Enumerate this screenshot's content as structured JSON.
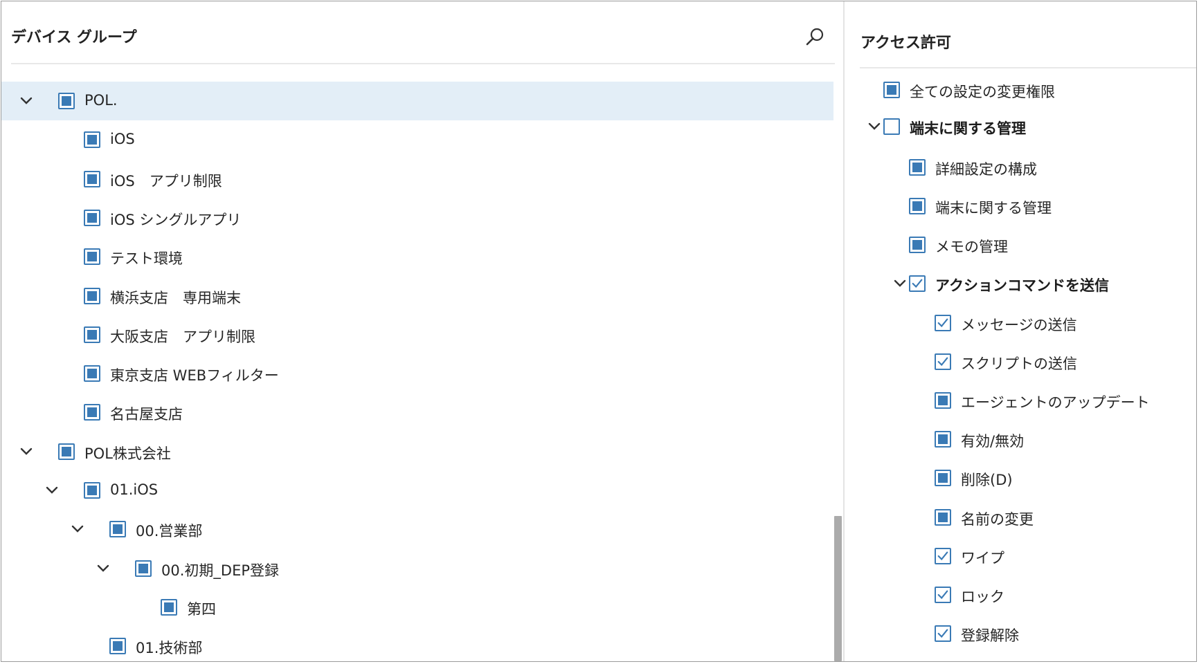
{
  "device_group": {
    "title": "デバイス グループ",
    "search_icon": "search-icon",
    "items": [
      {
        "label": "POL.",
        "level": 0,
        "expandable": true,
        "selected": true,
        "check": "partial"
      },
      {
        "label": "iOS",
        "level": 1,
        "expandable": false,
        "check": "partial"
      },
      {
        "label": "iOS　アプリ制限",
        "level": 1,
        "expandable": false,
        "check": "partial"
      },
      {
        "label": "iOS シングルアプリ",
        "level": 1,
        "expandable": false,
        "check": "partial"
      },
      {
        "label": "テスト環境",
        "level": 1,
        "expandable": false,
        "check": "partial"
      },
      {
        "label": "横浜支店　専用端末",
        "level": 1,
        "expandable": false,
        "check": "partial"
      },
      {
        "label": "大阪支店　アプリ制限",
        "level": 1,
        "expandable": false,
        "check": "partial"
      },
      {
        "label": "東京支店 WEBフィルター",
        "level": 1,
        "expandable": false,
        "check": "partial"
      },
      {
        "label": "名古屋支店",
        "level": 1,
        "expandable": false,
        "check": "partial"
      },
      {
        "label": "POL株式会社",
        "level": 0,
        "expandable": true,
        "check": "partial"
      },
      {
        "label": "01.iOS",
        "level": 1,
        "expandable": true,
        "check": "partial"
      },
      {
        "label": "00.営業部",
        "level": 2,
        "expandable": true,
        "check": "partial"
      },
      {
        "label": "00.初期_DEP登録",
        "level": 3,
        "expandable": true,
        "check": "partial"
      },
      {
        "label": "第四",
        "level": 4,
        "expandable": false,
        "check": "partial"
      },
      {
        "label": "01.技術部",
        "level": 2,
        "expandable": false,
        "check": "partial"
      }
    ]
  },
  "access": {
    "title": "アクセス許可",
    "items": [
      {
        "label": "全ての設定の変更権限",
        "level": 0,
        "expandable": false,
        "check": "partial",
        "bold": false
      },
      {
        "label": "端末に関する管理",
        "level": 0,
        "expandable": true,
        "check": "none",
        "bold": true
      },
      {
        "label": "詳細設定の構成",
        "level": 1,
        "expandable": false,
        "check": "partial",
        "bold": false
      },
      {
        "label": "端末に関する管理",
        "level": 1,
        "expandable": false,
        "check": "partial",
        "bold": false
      },
      {
        "label": "メモの管理",
        "level": 1,
        "expandable": false,
        "check": "partial",
        "bold": false
      },
      {
        "label": "アクションコマンドを送信",
        "level": 1,
        "expandable": true,
        "check": "checked",
        "bold": true
      },
      {
        "label": "メッセージの送信",
        "level": 2,
        "expandable": false,
        "check": "checked",
        "bold": false
      },
      {
        "label": "スクリプトの送信",
        "level": 2,
        "expandable": false,
        "check": "checked",
        "bold": false
      },
      {
        "label": "エージェントのアップデート",
        "level": 2,
        "expandable": false,
        "check": "partial",
        "bold": false
      },
      {
        "label": "有効/無効",
        "level": 2,
        "expandable": false,
        "check": "partial",
        "bold": false
      },
      {
        "label": "削除(D)",
        "level": 2,
        "expandable": false,
        "check": "partial",
        "bold": false
      },
      {
        "label": "名前の変更",
        "level": 2,
        "expandable": false,
        "check": "partial",
        "bold": false
      },
      {
        "label": "ワイプ",
        "level": 2,
        "expandable": false,
        "check": "checked",
        "bold": false
      },
      {
        "label": "ロック",
        "level": 2,
        "expandable": false,
        "check": "checked",
        "bold": false
      },
      {
        "label": "登録解除",
        "level": 2,
        "expandable": false,
        "check": "checked",
        "bold": false
      }
    ]
  },
  "colors": {
    "accent": "#3a7ab5",
    "selected_row": "#e3eef7",
    "scrollbar": "#ababab",
    "divider": "#e3e3e3"
  }
}
